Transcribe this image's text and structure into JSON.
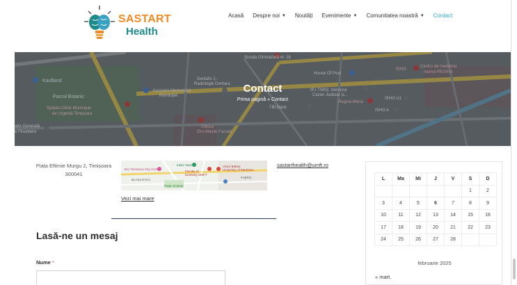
{
  "brand": {
    "line1": "SASTART",
    "line2": "Health"
  },
  "nav": {
    "items": [
      {
        "label": "Acasă",
        "caret": false,
        "active": false
      },
      {
        "label": "Despre noi",
        "caret": true,
        "active": false
      },
      {
        "label": "Noutăți",
        "caret": false,
        "active": false
      },
      {
        "label": "Evenimente",
        "caret": true,
        "active": false
      },
      {
        "label": "Comunitatea noastră",
        "caret": true,
        "active": false
      },
      {
        "label": "Contact",
        "caret": false,
        "active": true
      }
    ]
  },
  "hero": {
    "title": "Contact",
    "breadcrumb_home": "Prima pagină",
    "breadcrumb_sep": "»",
    "breadcrumb_current": "Contact",
    "map_labels": {
      "kaufland": "Kaufland",
      "parc": "Parcul Botanic",
      "spital": "Spitalul Clinic Municipal\nde Urgență Timișoara",
      "asociatia": "Asociația Memorialul\nRevoluției",
      "dentalis": "Dentalis 1 -\nRadiologie Dentara",
      "house": "House Of Pool",
      "isho": "ISHO",
      "centru": "Centru de medicina\nmuncii REGINA",
      "ipj": "IPJ TIMIȘ. Serviciul\nCazier Judiciar și...",
      "regina": "Regina Maria",
      "tbi": "TBI Bank",
      "clinica": "Clinica\nOro-Maxilo Facială",
      "isho_u1": "ISHO U1",
      "isho_a": "ISHO A",
      "gara": "ația Generală\ne Finanțelor",
      "scoala": "Școala Gimnazială nr. 16"
    }
  },
  "contact": {
    "address": "Piața Eftimie Murgu 2, Timișoara 300041",
    "map_labels": [
      "Iulius Town",
      "Victor Babeș University of Medicine...",
      "Faculty of Dentistry UMFT",
      "Bro Timișoara City Center",
      "Piața Victoriei",
      "BLAȘCOVICI",
      "FABRIC"
    ],
    "view_more": "Vezi mai mare",
    "email": "sastarthealth@umft.ro"
  },
  "form": {
    "title": "Lasă-ne un mesaj",
    "name_label": "Nume",
    "required_mark": "*",
    "name_value": ""
  },
  "calendar": {
    "headers": [
      "L",
      "Ma",
      "Mi",
      "J",
      "V",
      "S",
      "D"
    ],
    "weeks": [
      [
        "",
        "",
        "",
        "",
        "",
        "1",
        "2"
      ],
      [
        "3",
        "4",
        "5",
        "6",
        "7",
        "8",
        "9"
      ],
      [
        "10",
        "11",
        "12",
        "13",
        "14",
        "15",
        "16"
      ],
      [
        "17",
        "18",
        "19",
        "20",
        "21",
        "22",
        "23"
      ],
      [
        "24",
        "25",
        "26",
        "27",
        "28",
        "",
        ""
      ]
    ],
    "today": "6",
    "caption": "februarie 2025",
    "prev_link": "« mart."
  },
  "colors": {
    "accent": "#2aa8c9",
    "brand_orange": "#f08a24",
    "brand_teal": "#1f8a8a",
    "required": "#e04848"
  }
}
